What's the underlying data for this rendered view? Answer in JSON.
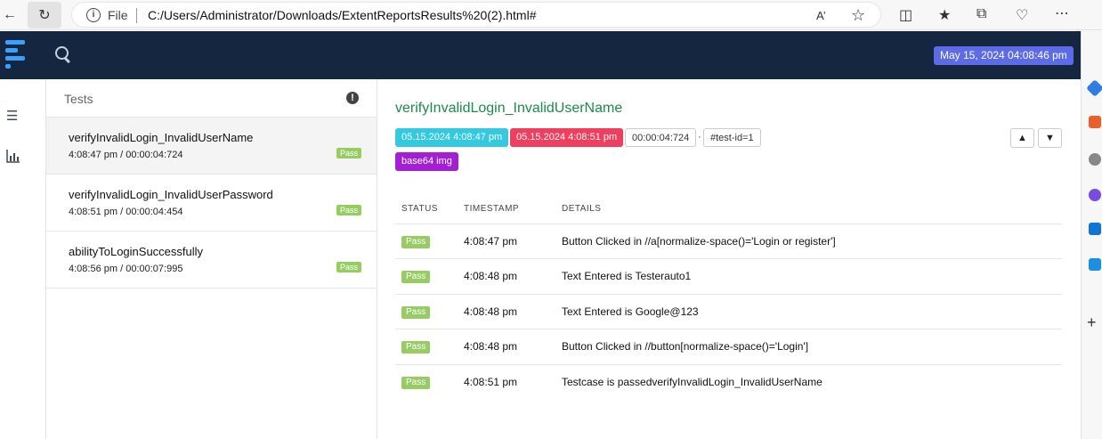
{
  "browser": {
    "file_label": "File",
    "url": "C:/Users/Administrator/Downloads/ExtentReportsResults%20(2).html#"
  },
  "header": {
    "date": "May 15, 2024 04:08:46 pm"
  },
  "tests_panel": {
    "title": "Tests",
    "items": [
      {
        "name": "verifyInvalidLogin_InvalidUserName",
        "time": "4:08:47 pm / 00:00:04:724",
        "status": "Pass"
      },
      {
        "name": "verifyInvalidLogin_InvalidUserPassword",
        "time": "4:08:51 pm / 00:00:04:454",
        "status": "Pass"
      },
      {
        "name": "abilityToLoginSuccessfully",
        "time": "4:08:56 pm / 00:00:07:995",
        "status": "Pass"
      }
    ]
  },
  "detail": {
    "title": "verifyInvalidLogin_InvalidUserName",
    "start": "05.15.2024 4:08:47 pm",
    "end": "05.15.2024 4:08:51 pm",
    "duration": "00:00:04:724",
    "separator": "·",
    "test_id": "#test-id=1",
    "attachment": "base64 img",
    "columns": [
      "STATUS",
      "TIMESTAMP",
      "DETAILS"
    ],
    "logs": [
      {
        "status": "Pass",
        "time": "4:08:47 pm",
        "details": "Button Clicked in //a[normalize-space()='Login or register']"
      },
      {
        "status": "Pass",
        "time": "4:08:48 pm",
        "details": "Text Entered is Testerauto1"
      },
      {
        "status": "Pass",
        "time": "4:08:48 pm",
        "details": "Text Entered is Google@123"
      },
      {
        "status": "Pass",
        "time": "4:08:48 pm",
        "details": "Button Clicked in //button[normalize-space()='Login']"
      },
      {
        "status": "Pass",
        "time": "4:08:51 pm",
        "details": "Testcase is passedverifyInvalidLogin_InvalidUserName"
      }
    ]
  },
  "colors": {
    "navbar": "#142640",
    "pass": "#97cc64",
    "start_tag": "#33c9e0",
    "end_tag": "#f03e5e",
    "attachment_tag": "#a31fd4",
    "date_badge": "#5e6be6",
    "title_green": "#1e8a4a"
  }
}
